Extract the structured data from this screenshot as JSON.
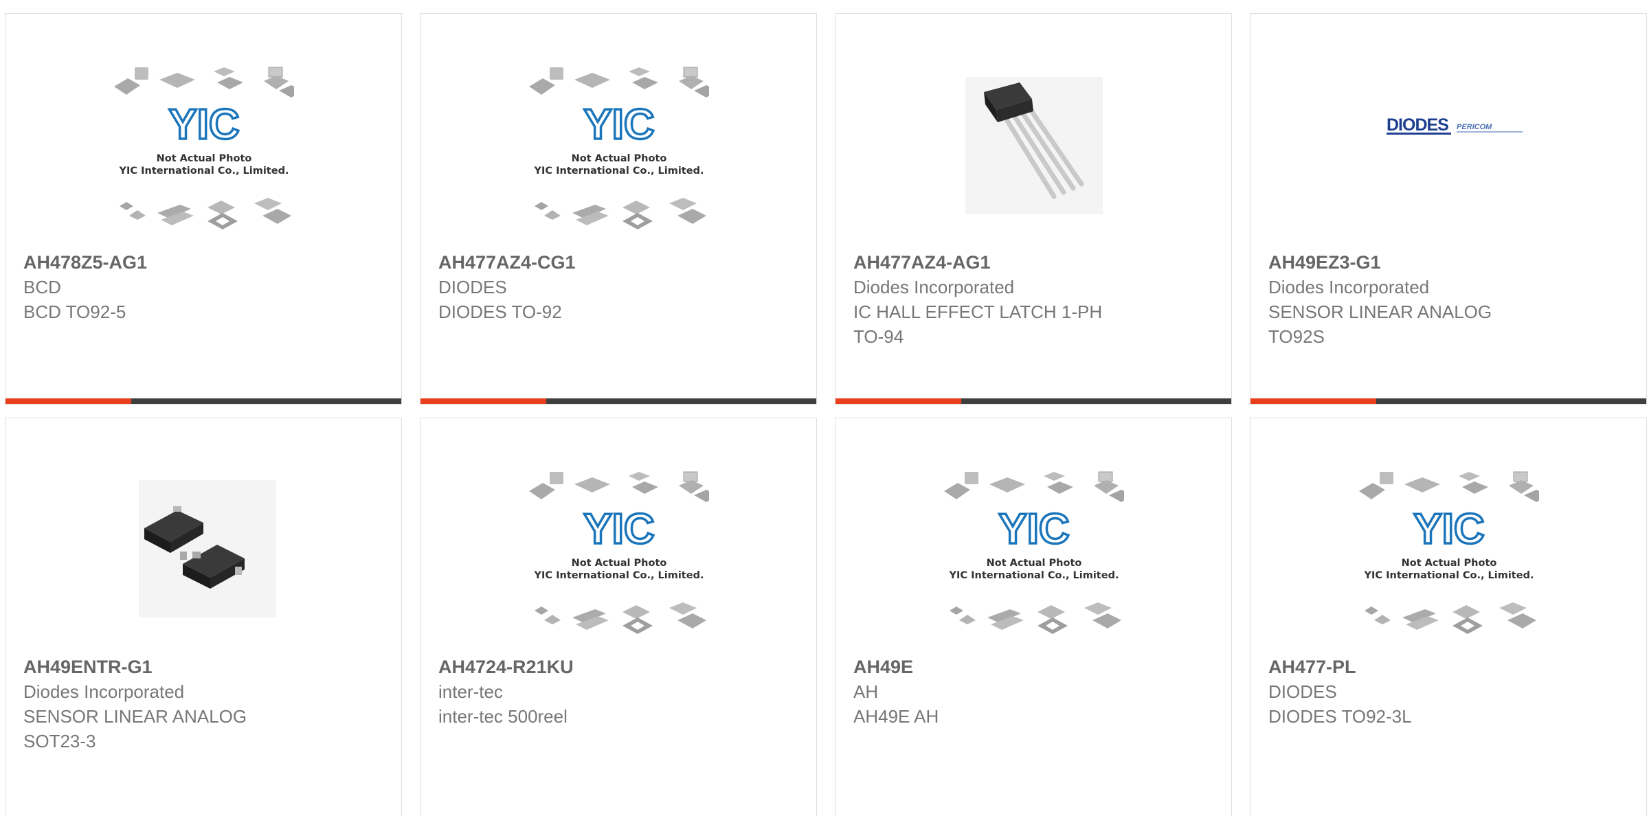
{
  "placeholder": {
    "logo": "YIC",
    "line1": "Not Actual Photo",
    "line2": "YIC International Co., Limited."
  },
  "brand_logo": {
    "primary": "DIODES",
    "secondary": "PERICOM"
  },
  "colors": {
    "accent": "#e8401f",
    "bar": "#3f3f3f",
    "border": "#dedede",
    "yic_blue": "#1b75bb"
  },
  "products": [
    {
      "part_number": "AH478Z5-AG1",
      "manufacturer": "BCD",
      "description": "BCD TO92-5",
      "image": "placeholder"
    },
    {
      "part_number": "AH477AZ4-CG1",
      "manufacturer": "DIODES",
      "description": "DIODES TO-92",
      "image": "placeholder"
    },
    {
      "part_number": "AH477AZ4-AG1",
      "manufacturer": "Diodes Incorporated",
      "description": "IC HALL EFFECT LATCH 1-PH\nTO-94",
      "image": "to94-photo"
    },
    {
      "part_number": "AH49EZ3-G1",
      "manufacturer": "Diodes Incorporated",
      "description": "SENSOR LINEAR ANALOG\nTO92S",
      "image": "diodes-logo"
    },
    {
      "part_number": "AH49ENTR-G1",
      "manufacturer": "Diodes Incorporated",
      "description": "SENSOR LINEAR ANALOG\nSOT23-3",
      "image": "sot23-photo"
    },
    {
      "part_number": "AH4724-R21KU",
      "manufacturer": "inter-tec",
      "description": "inter-tec 500reel",
      "image": "placeholder"
    },
    {
      "part_number": "AH49E",
      "manufacturer": "AH",
      "description": "AH49E AH",
      "image": "placeholder"
    },
    {
      "part_number": "AH477-PL",
      "manufacturer": "DIODES",
      "description": "DIODES TO92-3L",
      "image": "placeholder"
    }
  ]
}
